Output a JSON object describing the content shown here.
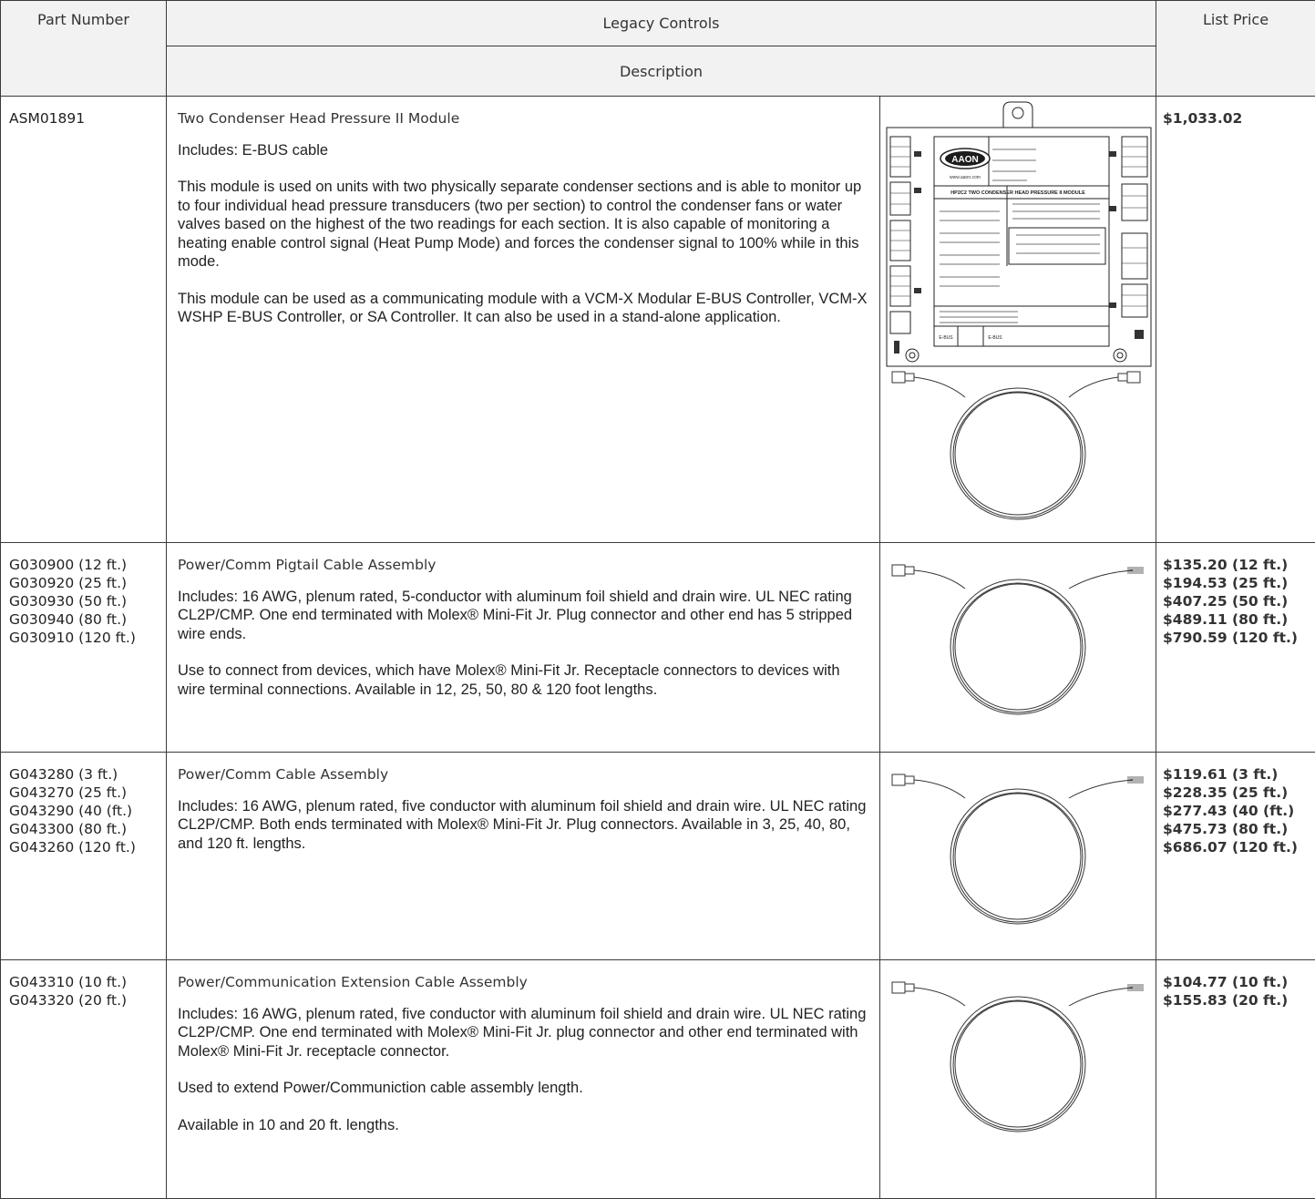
{
  "header": {
    "part_number": "Part Number",
    "legacy_controls": "Legacy Controls",
    "description": "Description",
    "list_price": "List Price"
  },
  "rows": [
    {
      "part_numbers": [
        "ASM01891"
      ],
      "title": "Two Condenser Head Pressure II Module",
      "includes": "Includes: E-BUS cable",
      "paragraphs": [
        "This module is used on units with two physically separate condenser sections and is able to monitor up to four individual head pressure transducers (two per section) to control the condenser fans or water valves based on the highest of the two readings for each section. It is also capable of monitoring a heating enable control signal (Heat Pump Mode) and forces the condenser signal to 100% while in this mode.",
        "This module can be used as a communicating module with a VCM-X Modular E-BUS Controller, VCM-X WSHP E-BUS Controller, or SA Controller. It can also be used in a stand-alone application."
      ],
      "prices": [
        "$1,033.02"
      ],
      "image": {
        "brand": "AAON",
        "module_title": "HP2C2 TWO CONDENSER HEAD PRESSURE II MODULE",
        "pn_label": "AAON P/N: ASM01891",
        "web": "www.aaon.com",
        "ebus_left": "E-BUS",
        "ebus_right": "E-BUS"
      }
    },
    {
      "part_numbers": [
        "G030900 (12 ft.)",
        "G030920 (25 ft.)",
        "G030930 (50 ft.)",
        "G030940 (80 ft.)",
        "G030910 (120 ft.)"
      ],
      "title": "Power/Comm Pigtail Cable Assembly",
      "includes": "Includes: 16 AWG, plenum rated, 5-conductor with aluminum foil shield and drain wire. UL NEC rating CL2P/CMP. One end terminated with Molex® Mini-Fit Jr. Plug connector and other end has 5 stripped wire ends.",
      "paragraphs": [
        "Use to connect from devices, which have Molex® Mini-Fit Jr. Receptacle connectors to devices with wire terminal connections. Available in 12, 25, 50, 80 & 120 foot lengths."
      ],
      "prices": [
        "$135.20 (12 ft.)",
        "$194.53 (25 ft.)",
        "$407.25 (50 ft.)",
        "$489.11 (80 ft.)",
        "$790.59 (120 ft.)"
      ]
    },
    {
      "part_numbers": [
        "G043280 (3 ft.)",
        "G043270 (25 ft.)",
        "G043290 (40 (ft.)",
        "G043300 (80 ft.)",
        "G043260 (120 ft.)"
      ],
      "title": "Power/Comm Cable Assembly",
      "includes": "Includes: 16 AWG, plenum rated, five conductor with aluminum foil shield and drain wire. UL NEC rating CL2P/CMP. Both ends terminated with Molex® Mini-Fit Jr. Plug connectors. Available in 3, 25, 40, 80, and 120 ft. lengths.",
      "paragraphs": [],
      "prices": [
        "$119.61 (3 ft.)",
        "$228.35 (25 ft.)",
        "$277.43 (40 (ft.)",
        "$475.73 (80 ft.)",
        "$686.07 (120 ft.)"
      ]
    },
    {
      "part_numbers": [
        "G043310 (10 ft.)",
        "G043320 (20 ft.)"
      ],
      "title": "Power/Communication Extension Cable Assembly",
      "includes": "Includes: 16 AWG, plenum rated, five conductor with aluminum foil shield and drain wire. UL NEC rating CL2P/CMP. One end terminated with Molex® Mini-Fit Jr. plug connector and other end terminated with Molex® Mini-Fit Jr. receptacle connector.",
      "paragraphs": [
        "Used to extend Power/Communiction cable assembly length.",
        "Available in 10 and 20 ft. lengths."
      ],
      "prices": [
        "$104.77 (10 ft.)",
        "$155.83  (20 ft.)"
      ]
    }
  ]
}
